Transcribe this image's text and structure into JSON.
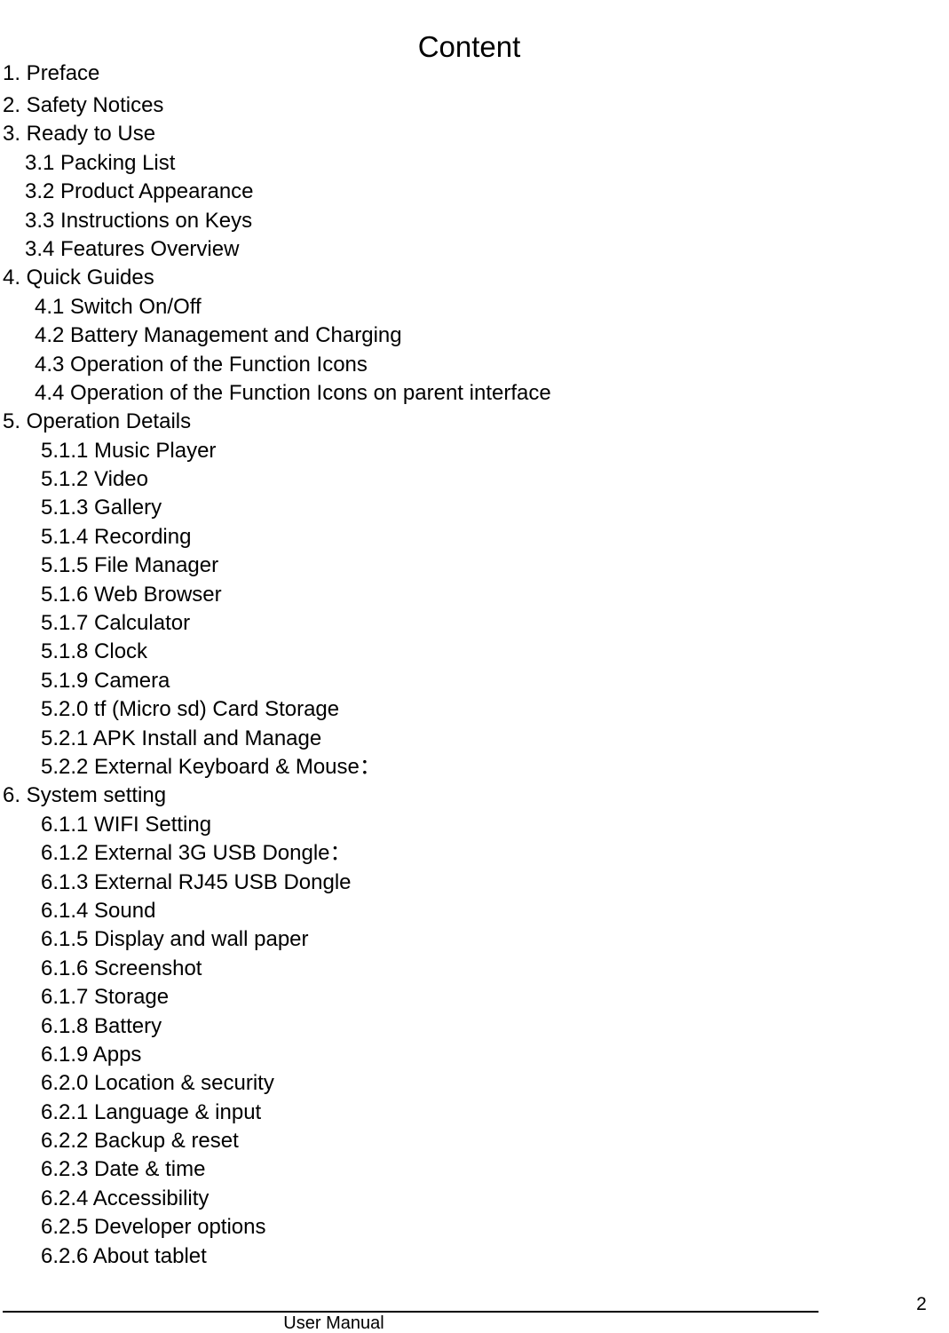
{
  "document": {
    "title": "Content"
  },
  "toc": {
    "entries": [
      {
        "label": "1. Preface",
        "level": 0
      },
      {
        "label": "2. Safety Notices",
        "level": 0
      },
      {
        "label": "3. Ready to Use",
        "level": 0
      },
      {
        "label": "3.1 Packing List",
        "level": 1
      },
      {
        "label": "3.2 Product Appearance",
        "level": 1
      },
      {
        "label": "3.3 Instructions on Keys",
        "level": 1
      },
      {
        "label": "3.4 Features Overview",
        "level": 1
      },
      {
        "label": "4. Quick Guides",
        "level": 0
      },
      {
        "label": "4.1 Switch On/Off",
        "level": 2
      },
      {
        "label": "4.2 Battery Management and Charging",
        "level": 2
      },
      {
        "label": "4.3 Operation of the Function Icons",
        "level": 2
      },
      {
        "label": "4.4 Operation of the Function Icons on parent interface",
        "level": 2
      },
      {
        "label": "5. Operation Details",
        "level": 0
      },
      {
        "label": "5.1.1 Music Player",
        "level": 3
      },
      {
        "label": "5.1.2 Video",
        "level": 3
      },
      {
        "label": "5.1.3 Gallery",
        "level": 3
      },
      {
        "label": "5.1.4 Recording",
        "level": 3
      },
      {
        "label": "5.1.5 File Manager",
        "level": 3
      },
      {
        "label": "5.1.6 Web Browser",
        "level": 3
      },
      {
        "label": "5.1.7 Calculator",
        "level": 3
      },
      {
        "label": "5.1.8 Clock",
        "level": 3
      },
      {
        "label": "5.1.9 Camera",
        "level": 3
      },
      {
        "label": "5.2.0 tf (Micro sd) Card Storage",
        "level": 3
      },
      {
        "label": "5.2.1 APK Install and Manage",
        "level": 3
      },
      {
        "label": "5.2.2 External Keyboard & Mouse：",
        "level": 3
      },
      {
        "label": "6. System setting",
        "level": 0
      },
      {
        "label": "6.1.1 WIFI Setting",
        "level": 3
      },
      {
        "label": "6.1.2 External 3G USB Dongle：",
        "level": 3
      },
      {
        "label": "6.1.3 External RJ45 USB Dongle",
        "level": 3
      },
      {
        "label": "6.1.4 Sound",
        "level": 3
      },
      {
        "label": "6.1.5 Display and wall paper",
        "level": 3
      },
      {
        "label": "6.1.6 Screenshot",
        "level": 3
      },
      {
        "label": "6.1.7 Storage",
        "level": 3
      },
      {
        "label": "6.1.8 Battery",
        "level": 3
      },
      {
        "label": "6.1.9 Apps",
        "level": 3
      },
      {
        "label": "6.2.0 Location & security",
        "level": 3
      },
      {
        "label": "6.2.1 Language & input",
        "level": 3
      },
      {
        "label": "6.2.2 Backup & reset",
        "level": 3
      },
      {
        "label": "6.2.3 Date & time",
        "level": 3
      },
      {
        "label": "6.2.4 Accessibility",
        "level": 3
      },
      {
        "label": "6.2.5 Developer options",
        "level": 3
      },
      {
        "label": "6.2.6 About tablet",
        "level": 3
      }
    ]
  },
  "footer": {
    "label": "User Manual",
    "page_number": "2"
  }
}
